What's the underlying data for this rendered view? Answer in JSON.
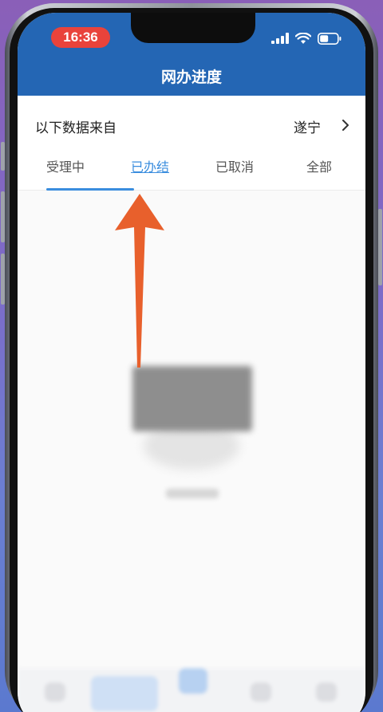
{
  "status_bar": {
    "time": "16:36",
    "icons": [
      "signal-icon",
      "wifi-icon",
      "battery-icon"
    ]
  },
  "header": {
    "title": "网办进度"
  },
  "source": {
    "label": "以下数据来自",
    "city": "遂宁"
  },
  "tabs": [
    {
      "label": "受理中",
      "active": false
    },
    {
      "label": "已办结",
      "active": true
    },
    {
      "label": "已取消",
      "active": false
    },
    {
      "label": "全部",
      "active": false
    }
  ],
  "colors": {
    "header": "#2466b4",
    "accent": "#3a8dde",
    "arrow": "#e8602c",
    "time_pill": "#e9433b"
  }
}
